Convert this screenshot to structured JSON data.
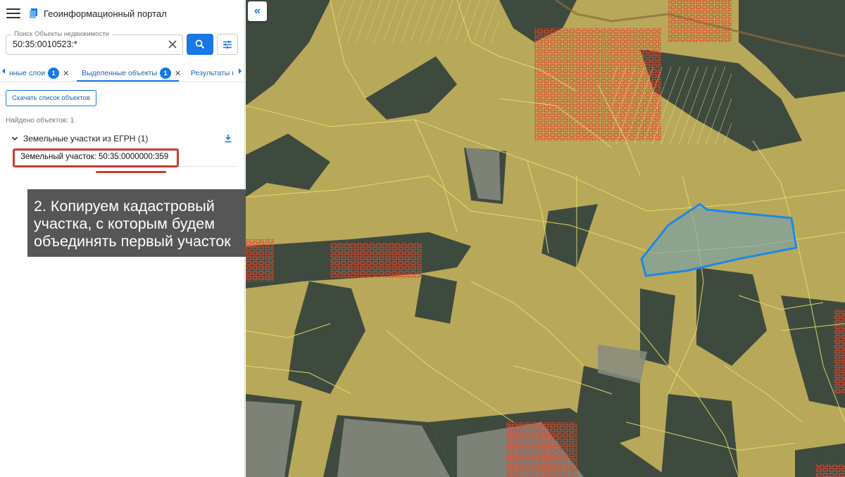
{
  "app": {
    "title": "Геоинформационный портал"
  },
  "search": {
    "label": "Поиск Объекты недвижимости",
    "value": "50:35:0010523:*"
  },
  "tabs": [
    {
      "label": "нные слои",
      "count": "1"
    },
    {
      "label": "Выделенные объекты",
      "count": "1"
    },
    {
      "label": "Результаты п"
    }
  ],
  "actions": {
    "download_list": "Скачать список объектов"
  },
  "results": {
    "found": "Найдено объектов: 1",
    "group_label": "Земельные участки из ЕГРН (1)",
    "item_label": "Земельный участок: 50:35:0000000:359"
  },
  "annotation": {
    "lines": [
      "2. Копируем кадастровый",
      "участка, с которым будем",
      "объединять первый участок"
    ]
  },
  "map": {
    "highlight_color": "#1e88e5",
    "parcel_line_color": "#e8e26a",
    "building_color": "#e0482d"
  },
  "icons": [
    "menu-icon",
    "logo-icon",
    "clear-icon",
    "search-icon",
    "filter-icon",
    "chevron-left-icon",
    "chevron-right-icon",
    "close-icon",
    "chevron-down-icon",
    "download-icon",
    "double-chevron-left-icon"
  ]
}
